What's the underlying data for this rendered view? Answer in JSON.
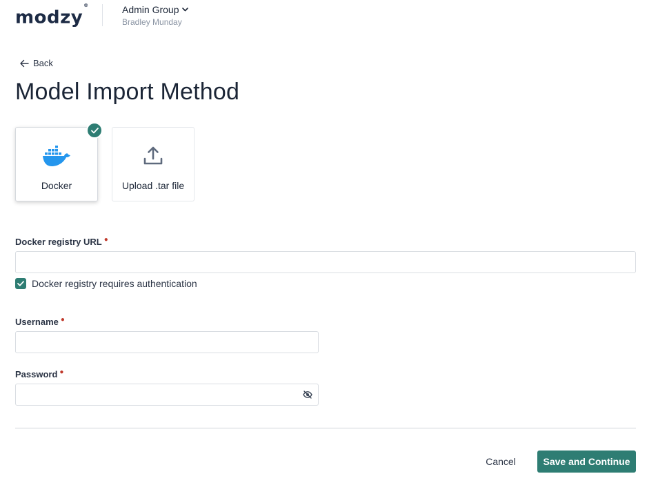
{
  "header": {
    "logo_text": "modzy",
    "logo_mark": "®",
    "group_name": "Admin Group",
    "user_name": "Bradley Munday"
  },
  "nav": {
    "back_label": "Back"
  },
  "page": {
    "title": "Model Import Method"
  },
  "methods": [
    {
      "label": "Docker",
      "icon": "docker-whale-icon",
      "selected": true
    },
    {
      "label": "Upload .tar file",
      "icon": "upload-icon",
      "selected": false
    }
  ],
  "form": {
    "registry_url": {
      "label": "Docker registry URL",
      "value": "",
      "required": true
    },
    "requires_auth": {
      "label": "Docker registry requires authentication",
      "checked": true
    },
    "username": {
      "label": "Username",
      "value": "",
      "required": true
    },
    "password": {
      "label": "Password",
      "value": "",
      "required": true
    }
  },
  "footer": {
    "cancel_label": "Cancel",
    "save_label": "Save and Continue"
  },
  "colors": {
    "accent": "#2e7d73",
    "docker_blue": "#2496ed",
    "required": "#c0392b",
    "text": "#1b2536"
  }
}
